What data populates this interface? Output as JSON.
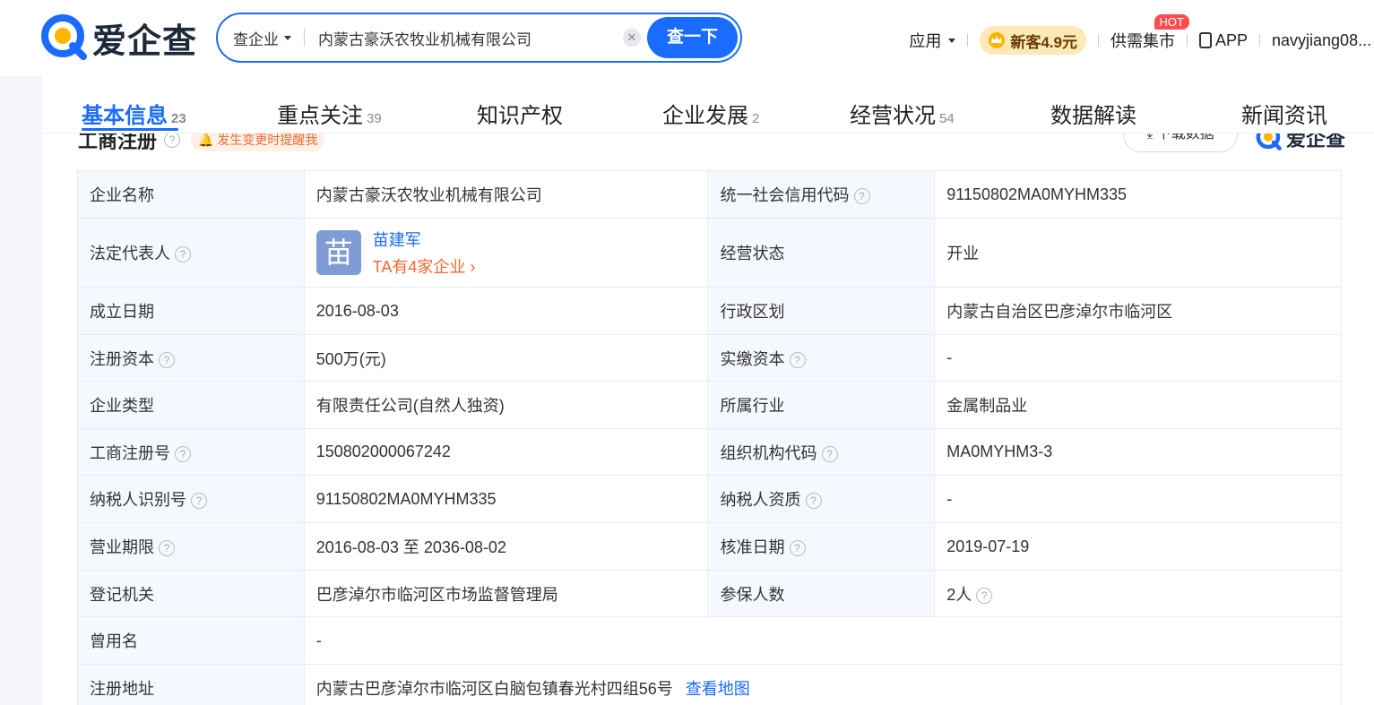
{
  "header": {
    "logo_text": "爱企查",
    "search_type": "查企业",
    "search_value": "内蒙古豪沃农牧业机械有限公司",
    "search_button": "查一下",
    "nav": {
      "apps": "应用",
      "promo": "新客4.9元",
      "supply": "供需集市",
      "hot": "HOT",
      "app": "APP",
      "user": "navyjiang08..."
    }
  },
  "tabs": [
    {
      "label": "基本信息",
      "count": "23"
    },
    {
      "label": "重点关注",
      "count": "39"
    },
    {
      "label": "知识产权",
      "count": ""
    },
    {
      "label": "企业发展",
      "count": "2"
    },
    {
      "label": "经营状况",
      "count": "54"
    },
    {
      "label": "数据解读",
      "count": ""
    },
    {
      "label": "新闻资讯",
      "count": ""
    }
  ],
  "section": {
    "title": "工商注册",
    "alert": "发生变更时提醒我",
    "download": "下载数据",
    "logo_text": "爱企查"
  },
  "info": {
    "company_name_label": "企业名称",
    "company_name": "内蒙古豪沃农牧业机械有限公司",
    "credit_code_label": "统一社会信用代码",
    "credit_code": "91150802MA0MYHM335",
    "legal_rep_label": "法定代表人",
    "legal_rep_avatar": "苗",
    "legal_rep_name": "苗建军",
    "legal_rep_link": "TA有4家企业",
    "status_label": "经营状态",
    "status": "开业",
    "founded_label": "成立日期",
    "founded": "2016-08-03",
    "region_label": "行政区划",
    "region": "内蒙古自治区巴彦淖尔市临河区",
    "reg_capital_label": "注册资本",
    "reg_capital": "500万(元)",
    "paid_capital_label": "实缴资本",
    "paid_capital": "-",
    "type_label": "企业类型",
    "type": "有限责任公司(自然人独资)",
    "industry_label": "所属行业",
    "industry": "金属制品业",
    "reg_no_label": "工商注册号",
    "reg_no": "150802000067242",
    "org_code_label": "组织机构代码",
    "org_code": "MA0MYHM3-3",
    "taxpayer_id_label": "纳税人识别号",
    "taxpayer_id": "91150802MA0MYHM335",
    "taxpayer_qual_label": "纳税人资质",
    "taxpayer_qual": "-",
    "term_label": "营业期限",
    "term": "2016-08-03 至 2036-08-02",
    "approval_label": "核准日期",
    "approval": "2019-07-19",
    "authority_label": "登记机关",
    "authority": "巴彦淖尔市临河区市场监督管理局",
    "insured_label": "参保人数",
    "insured": "2人",
    "former_name_label": "曾用名",
    "former_name": "-",
    "address_label": "注册地址",
    "address": "内蒙古巴彦淖尔市临河区白脑包镇春光村四组56号",
    "map_link": "查看地图"
  },
  "colors": {
    "accent": "#1a6bff",
    "orange": "#f06a2f",
    "label_bg": "#f5f8ff"
  }
}
